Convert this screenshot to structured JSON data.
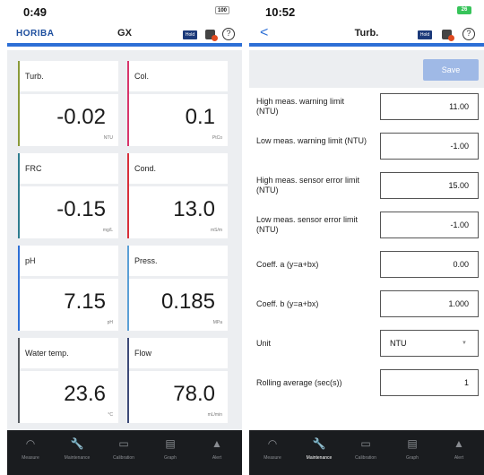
{
  "left": {
    "status_time": "0:49",
    "battery": "100",
    "brand": "HORIBA",
    "title": "GX",
    "hold": "Hold",
    "help": "?",
    "tiles": [
      {
        "label": "Turb.",
        "value": "-0.02",
        "unit": "NTU",
        "color": "#8a9a3a"
      },
      {
        "label": "Col.",
        "value": "0.1",
        "unit": "PtCo",
        "color": "#d8356b"
      },
      {
        "label": "FRC",
        "value": "-0.15",
        "unit": "mg/L",
        "color": "#2f7d8f"
      },
      {
        "label": "Cond.",
        "value": "13.0",
        "unit": "mS/m",
        "color": "#d8303a"
      },
      {
        "label": "pH",
        "value": "7.15",
        "unit": "pH",
        "color": "#2d6fd6"
      },
      {
        "label": "Press.",
        "value": "0.185",
        "unit": "MPa",
        "color": "#5a9fd6"
      },
      {
        "label": "Water temp.",
        "value": "23.6",
        "unit": "°C",
        "color": "#555a60"
      },
      {
        "label": "Flow",
        "value": "78.0",
        "unit": "mL/min",
        "color": "#3d4a78"
      }
    ]
  },
  "right": {
    "status_time": "10:52",
    "battery": "26",
    "back": "<",
    "title": "Turb.",
    "hold": "Hold",
    "help": "?",
    "save_label": "Save",
    "fields": [
      {
        "label": "High meas. warning limit (NTU)",
        "value": "11.00"
      },
      {
        "label": "Low meas. warning limit (NTU)",
        "value": "-1.00"
      },
      {
        "label": "High meas. sensor error limit (NTU)",
        "value": "15.00"
      },
      {
        "label": "Low meas. sensor error limit (NTU)",
        "value": "-1.00"
      },
      {
        "label": "Coeff. a (y=a+bx)",
        "value": "0.00"
      },
      {
        "label": "Coeff. b (y=a+bx)",
        "value": "1.000"
      },
      {
        "label": "Unit",
        "value": "NTU"
      },
      {
        "label": "Rolling average (sec(s))",
        "value": "1"
      }
    ]
  },
  "tabs": [
    {
      "label": "Measure",
      "icon": "gauge-icon"
    },
    {
      "label": "Maintenance",
      "icon": "wrench-icon"
    },
    {
      "label": "Calibration",
      "icon": "beaker-icon"
    },
    {
      "label": "Graph",
      "icon": "chart-icon"
    },
    {
      "label": "Alert",
      "icon": "warning-icon"
    }
  ]
}
